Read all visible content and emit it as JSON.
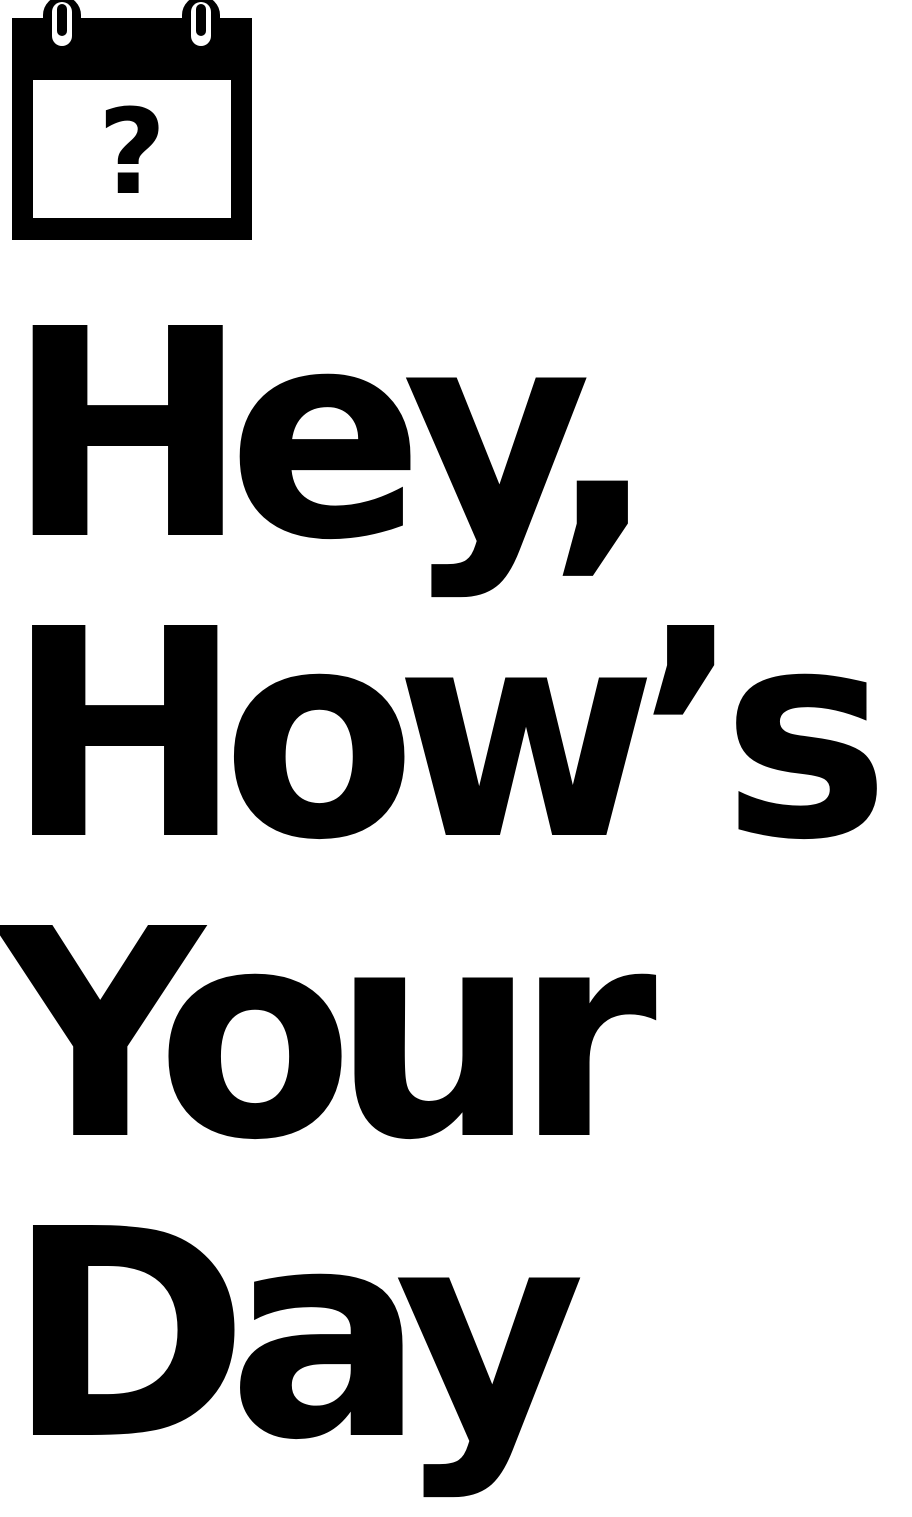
{
  "logo": {
    "icon": "calendar-question-icon",
    "icon_glyph": "?",
    "headline_lines": [
      "Hey,",
      "How’s",
      "Your",
      "Day"
    ]
  },
  "colors": {
    "foreground": "#000000",
    "background": "#ffffff"
  }
}
